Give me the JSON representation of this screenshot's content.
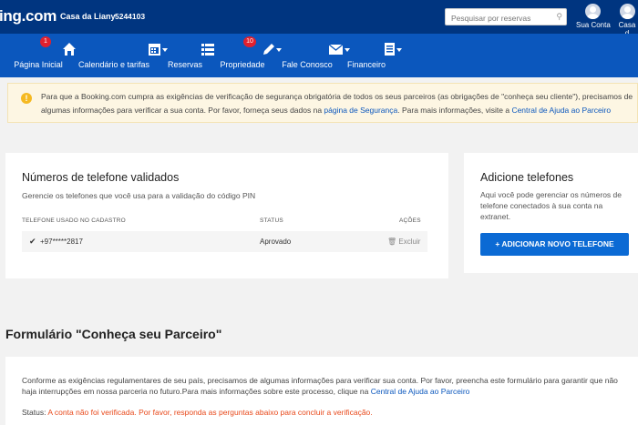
{
  "topbar": {
    "logo": "ing.com",
    "property_name": "Casa da Liany",
    "property_id": "5244103",
    "search_placeholder": "Pesquisar por reservas",
    "account_label": "Sua Conta",
    "account2_label": "Casa d"
  },
  "nav": {
    "items": [
      {
        "label": "Página Inicial",
        "icon": "home-icon",
        "badge": "1"
      },
      {
        "label": "Calendário e tarifas",
        "icon": "calendar-icon"
      },
      {
        "label": "Reservas",
        "icon": "list-icon"
      },
      {
        "label": "Propriedade",
        "icon": "edit-icon",
        "badge": "10"
      },
      {
        "label": "Fale Conosco",
        "icon": "mail-icon"
      },
      {
        "label": "Financeiro",
        "icon": "document-icon"
      }
    ]
  },
  "alert": {
    "text_before": "Para que a Booking.com cumpra as exigências de verificação de segurança obrigatória de todos os seus parceiros (as obrigações de \"conheça seu cliente\"), precisamos de algumas informações para verificar a sua conta. Por favor, forneça seus dados na ",
    "link1": "página de Segurança",
    "text_middle": ". Para mais informações, visite a ",
    "link2": "Central de Ajuda ao Parceiro"
  },
  "phones": {
    "title": "Números de telefone validados",
    "subtitle": "Gerencie os telefones que você usa para a validação do código PIN",
    "col_phone": "TELEFONE USADO NO CADASTRO",
    "col_status": "STATUS",
    "col_actions": "AÇÕES",
    "row": {
      "phone": "+97*****2817",
      "status": "Aprovado",
      "action": "Excluir"
    }
  },
  "add": {
    "title": "Adicione telefones",
    "description": "Aqui você pode gerenciar os números de telefone conectados à sua conta na extranet.",
    "button": "+ ADICIONAR NOVO TELEFONE"
  },
  "form": {
    "title": "Formulário \"Conheça seu Parceiro\"",
    "paragraph": "Conforme as exigências regulamentares de seu país, precisamos de algumas informações para verificar sua conta. Por favor, preencha este formulário para garantir que não haja interrupções em nossa parceria no futuro.Para mais informações sobre este processo, clique na ",
    "link": "Central de Ajuda ao Parceiro",
    "status_label": "Status:",
    "status_value": "A conta não foi verificada. Por favor, responda as perguntas abaixo para concluir a verificação."
  },
  "colors": {
    "topbar": "#003580",
    "navbar": "#0b57bd",
    "button": "#0b6ad4",
    "status_red": "#e8491b"
  }
}
